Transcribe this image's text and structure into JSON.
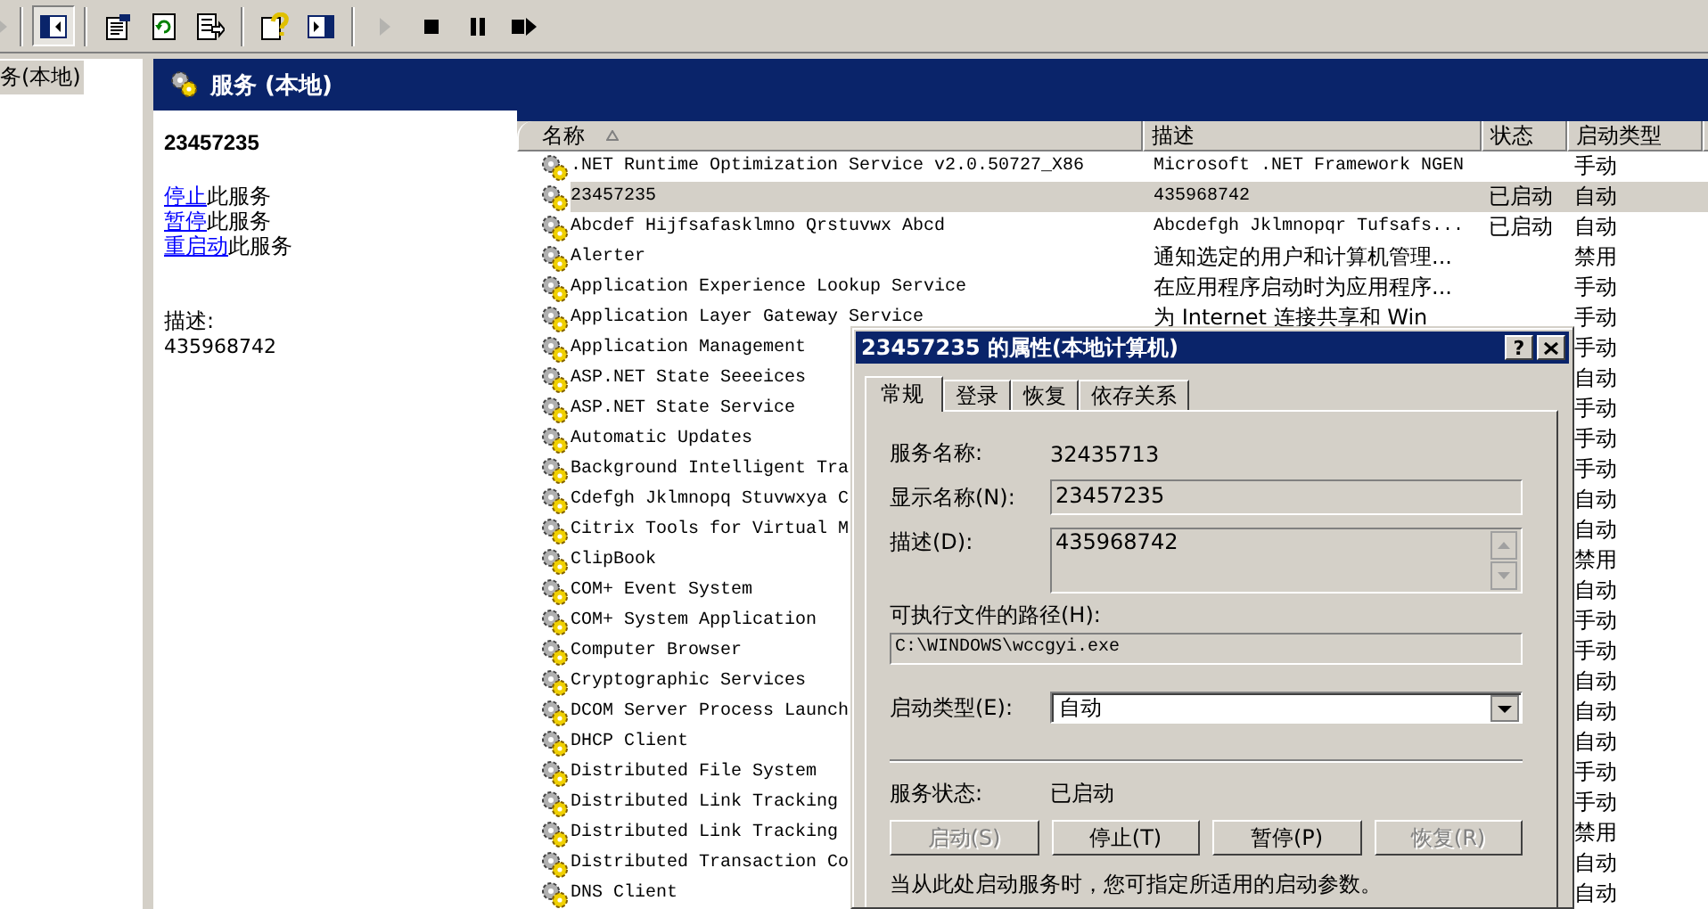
{
  "toolbar": {
    "buttons": [
      {
        "kind": "arrow",
        "pressed": false,
        "disabled": true
      },
      {
        "kind": "separator"
      },
      {
        "kind": "tree-toggle",
        "pressed": true,
        "disabled": false
      },
      {
        "kind": "separator"
      },
      {
        "kind": "properties",
        "pressed": false,
        "disabled": false
      },
      {
        "kind": "refresh",
        "pressed": false,
        "disabled": false
      },
      {
        "kind": "export",
        "pressed": false,
        "disabled": false
      },
      {
        "kind": "separator"
      },
      {
        "kind": "help",
        "pressed": false,
        "disabled": false
      },
      {
        "kind": "panel",
        "pressed": false,
        "disabled": false
      },
      {
        "kind": "separator"
      },
      {
        "kind": "play",
        "pressed": false,
        "disabled": true
      },
      {
        "kind": "stop",
        "pressed": false,
        "disabled": false
      },
      {
        "kind": "pause",
        "pressed": false,
        "disabled": false
      },
      {
        "kind": "restart",
        "pressed": false,
        "disabled": false
      }
    ]
  },
  "tree": {
    "items": [
      {
        "label": "务(本地)",
        "selected": true
      }
    ]
  },
  "header": {
    "title": "服务 (本地)"
  },
  "detail": {
    "title": "23457235",
    "actions": [
      {
        "link": "停止",
        "text": "此服务"
      },
      {
        "link": "暂停",
        "text": "此服务"
      },
      {
        "link": "重启动",
        "text": "此服务"
      }
    ],
    "description_label": "描述:",
    "description": "435968742"
  },
  "table": {
    "columns": [
      {
        "label": "名称",
        "sorted": true
      },
      {
        "label": "描述",
        "sorted": false
      },
      {
        "label": "状态",
        "sorted": false
      },
      {
        "label": "启动类型",
        "sorted": false
      }
    ],
    "rows": [
      {
        "name": ".NET Runtime Optimization Service v2.0.50727_X86",
        "description": "Microsoft .NET Framework NGEN",
        "startup": "手动",
        "selected": false
      },
      {
        "name": "23457235",
        "description": "435968742",
        "status": "已启动",
        "startup": "自动",
        "selected": true
      },
      {
        "name": "Abcdef Hijfsafasklmno Qrstuvwx Abcd",
        "description": "Abcdefgh Jklmnopqr Tufsafs...",
        "status": "已启动",
        "startup": "自动",
        "selected": false
      },
      {
        "name": "Alerter",
        "description": "通知选定的用户和计算机管理...",
        "startup": "禁用",
        "selected": false
      },
      {
        "name": "Application Experience Lookup Service",
        "description": "在应用程序启动时为应用程序...",
        "startup": "手动",
        "selected": false
      },
      {
        "name": "Application Layer Gateway Service",
        "description": "为 Internet 连接共享和 Win",
        "startup": "手动",
        "selected": false
      },
      {
        "name": "Application Management",
        "startup": "手动",
        "selected": false
      },
      {
        "name": "ASP.NET State Seeeices",
        "startup": "自动",
        "selected": false
      },
      {
        "name": "ASP.NET State Service",
        "startup": "手动",
        "selected": false
      },
      {
        "name": "Automatic Updates",
        "startup": "手动",
        "selected": false
      },
      {
        "name": "Background Intelligent Tra",
        "startup": "手动",
        "selected": false
      },
      {
        "name": "Cdefgh Jklmnopq Stuvwxya C",
        "startup": "自动",
        "selected": false
      },
      {
        "name": "Citrix Tools for Virtual M",
        "startup": "自动",
        "selected": false
      },
      {
        "name": "ClipBook",
        "startup": "禁用",
        "selected": false
      },
      {
        "name": "COM+ Event System",
        "startup": "自动",
        "selected": false
      },
      {
        "name": "COM+ System Application",
        "startup": "手动",
        "selected": false
      },
      {
        "name": "Computer Browser",
        "startup": "手动",
        "selected": false
      },
      {
        "name": "Cryptographic Services",
        "startup": "自动",
        "selected": false
      },
      {
        "name": "DCOM Server Process Launch",
        "startup": "自动",
        "selected": false
      },
      {
        "name": "DHCP Client",
        "startup": "自动",
        "selected": false
      },
      {
        "name": "Distributed File System",
        "startup": "手动",
        "selected": false
      },
      {
        "name": "Distributed Link Tracking",
        "startup": "手动",
        "selected": false
      },
      {
        "name": "Distributed Link Tracking",
        "startup": "禁用",
        "selected": false
      },
      {
        "name": "Distributed Transaction Co",
        "startup": "自动",
        "selected": false
      },
      {
        "name": "DNS Client",
        "startup": "自动",
        "selected": false
      }
    ]
  },
  "dialog": {
    "title": "23457235 的属性(本地计算机)",
    "help_button": "?",
    "tabs": [
      {
        "label": "常规",
        "selected": true
      },
      {
        "label": "登录",
        "selected": false
      },
      {
        "label": "恢复",
        "selected": false
      },
      {
        "label": "依存关系",
        "selected": false
      }
    ],
    "service_name": {
      "label": "服务名称:",
      "value": "32435713"
    },
    "display_name": {
      "label": "显示名称(N):",
      "value": "23457235"
    },
    "description": {
      "label": "描述(D):",
      "value": "435968742"
    },
    "path": {
      "label": "可执行文件的路径(H):",
      "value": "C:\\WINDOWS\\wccgyi.exe"
    },
    "startup_type": {
      "label": "启动类型(E):",
      "value": "自动"
    },
    "service_status": {
      "label": "服务状态:",
      "value": "已启动"
    },
    "buttons": [
      {
        "label": "启动(S)",
        "disabled": true
      },
      {
        "label": "停止(T)",
        "disabled": false
      },
      {
        "label": "暂停(P)",
        "disabled": false
      },
      {
        "label": "恢复(R)",
        "disabled": true
      }
    ],
    "note": "当从此处启动服务时，您可指定所适用的启动参数。"
  }
}
